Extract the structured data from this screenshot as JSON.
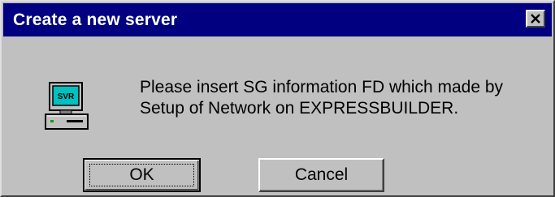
{
  "dialog": {
    "title": "Create a new server",
    "close_icon": "close-icon",
    "icon": "server-computer-icon",
    "icon_label": "SVR",
    "message_lines": [
      "Please insert SG information FD which made by",
      "Setup of Network on EXPRESSBUILDER."
    ],
    "buttons": {
      "ok": "OK",
      "cancel": "Cancel"
    }
  },
  "colors": {
    "titlebar": "#000080",
    "face": "#c0c0c0",
    "icon_screen": "#00c0c0"
  }
}
